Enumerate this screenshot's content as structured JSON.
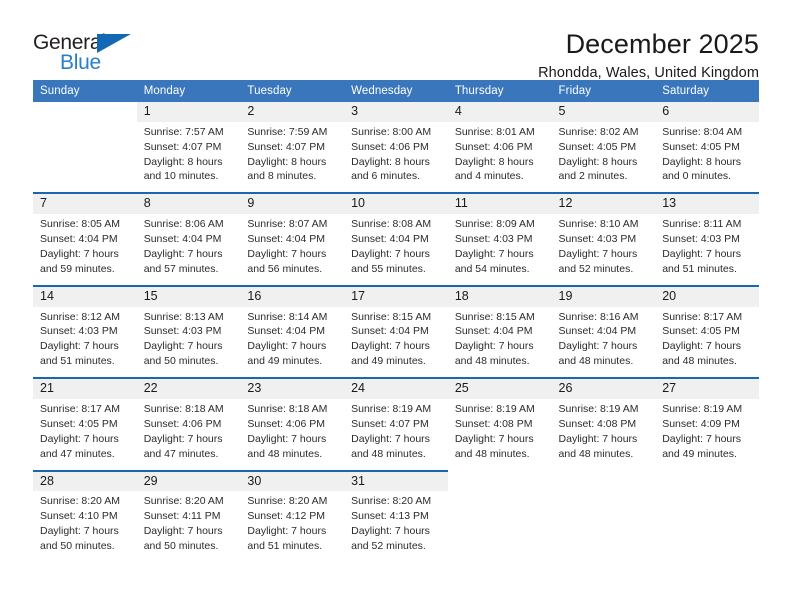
{
  "brand": {
    "word_one": "General",
    "word_two": "Blue",
    "triangle_icon": "triangle-icon",
    "accent_color": "#2a7fc9",
    "dark_color": "#231f20"
  },
  "header": {
    "title": "December 2025",
    "location": "Rhondda, Wales, United Kingdom"
  },
  "calendar": {
    "header_color": "#3a76bc",
    "separator_color": "#1768ad",
    "daynum_background": "#f0f0f0",
    "weekday_headers": [
      "Sunday",
      "Monday",
      "Tuesday",
      "Wednesday",
      "Thursday",
      "Friday",
      "Saturday"
    ],
    "weeks": [
      [
        {
          "day": "",
          "lines": []
        },
        {
          "day": "1",
          "lines": [
            "Sunrise: 7:57 AM",
            "Sunset: 4:07 PM",
            "Daylight: 8 hours",
            "and 10 minutes."
          ]
        },
        {
          "day": "2",
          "lines": [
            "Sunrise: 7:59 AM",
            "Sunset: 4:07 PM",
            "Daylight: 8 hours",
            "and 8 minutes."
          ]
        },
        {
          "day": "3",
          "lines": [
            "Sunrise: 8:00 AM",
            "Sunset: 4:06 PM",
            "Daylight: 8 hours",
            "and 6 minutes."
          ]
        },
        {
          "day": "4",
          "lines": [
            "Sunrise: 8:01 AM",
            "Sunset: 4:06 PM",
            "Daylight: 8 hours",
            "and 4 minutes."
          ]
        },
        {
          "day": "5",
          "lines": [
            "Sunrise: 8:02 AM",
            "Sunset: 4:05 PM",
            "Daylight: 8 hours",
            "and 2 minutes."
          ]
        },
        {
          "day": "6",
          "lines": [
            "Sunrise: 8:04 AM",
            "Sunset: 4:05 PM",
            "Daylight: 8 hours",
            "and 0 minutes."
          ]
        }
      ],
      [
        {
          "day": "7",
          "lines": [
            "Sunrise: 8:05 AM",
            "Sunset: 4:04 PM",
            "Daylight: 7 hours",
            "and 59 minutes."
          ]
        },
        {
          "day": "8",
          "lines": [
            "Sunrise: 8:06 AM",
            "Sunset: 4:04 PM",
            "Daylight: 7 hours",
            "and 57 minutes."
          ]
        },
        {
          "day": "9",
          "lines": [
            "Sunrise: 8:07 AM",
            "Sunset: 4:04 PM",
            "Daylight: 7 hours",
            "and 56 minutes."
          ]
        },
        {
          "day": "10",
          "lines": [
            "Sunrise: 8:08 AM",
            "Sunset: 4:04 PM",
            "Daylight: 7 hours",
            "and 55 minutes."
          ]
        },
        {
          "day": "11",
          "lines": [
            "Sunrise: 8:09 AM",
            "Sunset: 4:03 PM",
            "Daylight: 7 hours",
            "and 54 minutes."
          ]
        },
        {
          "day": "12",
          "lines": [
            "Sunrise: 8:10 AM",
            "Sunset: 4:03 PM",
            "Daylight: 7 hours",
            "and 52 minutes."
          ]
        },
        {
          "day": "13",
          "lines": [
            "Sunrise: 8:11 AM",
            "Sunset: 4:03 PM",
            "Daylight: 7 hours",
            "and 51 minutes."
          ]
        }
      ],
      [
        {
          "day": "14",
          "lines": [
            "Sunrise: 8:12 AM",
            "Sunset: 4:03 PM",
            "Daylight: 7 hours",
            "and 51 minutes."
          ]
        },
        {
          "day": "15",
          "lines": [
            "Sunrise: 8:13 AM",
            "Sunset: 4:03 PM",
            "Daylight: 7 hours",
            "and 50 minutes."
          ]
        },
        {
          "day": "16",
          "lines": [
            "Sunrise: 8:14 AM",
            "Sunset: 4:04 PM",
            "Daylight: 7 hours",
            "and 49 minutes."
          ]
        },
        {
          "day": "17",
          "lines": [
            "Sunrise: 8:15 AM",
            "Sunset: 4:04 PM",
            "Daylight: 7 hours",
            "and 49 minutes."
          ]
        },
        {
          "day": "18",
          "lines": [
            "Sunrise: 8:15 AM",
            "Sunset: 4:04 PM",
            "Daylight: 7 hours",
            "and 48 minutes."
          ]
        },
        {
          "day": "19",
          "lines": [
            "Sunrise: 8:16 AM",
            "Sunset: 4:04 PM",
            "Daylight: 7 hours",
            "and 48 minutes."
          ]
        },
        {
          "day": "20",
          "lines": [
            "Sunrise: 8:17 AM",
            "Sunset: 4:05 PM",
            "Daylight: 7 hours",
            "and 48 minutes."
          ]
        }
      ],
      [
        {
          "day": "21",
          "lines": [
            "Sunrise: 8:17 AM",
            "Sunset: 4:05 PM",
            "Daylight: 7 hours",
            "and 47 minutes."
          ]
        },
        {
          "day": "22",
          "lines": [
            "Sunrise: 8:18 AM",
            "Sunset: 4:06 PM",
            "Daylight: 7 hours",
            "and 47 minutes."
          ]
        },
        {
          "day": "23",
          "lines": [
            "Sunrise: 8:18 AM",
            "Sunset: 4:06 PM",
            "Daylight: 7 hours",
            "and 48 minutes."
          ]
        },
        {
          "day": "24",
          "lines": [
            "Sunrise: 8:19 AM",
            "Sunset: 4:07 PM",
            "Daylight: 7 hours",
            "and 48 minutes."
          ]
        },
        {
          "day": "25",
          "lines": [
            "Sunrise: 8:19 AM",
            "Sunset: 4:08 PM",
            "Daylight: 7 hours",
            "and 48 minutes."
          ]
        },
        {
          "day": "26",
          "lines": [
            "Sunrise: 8:19 AM",
            "Sunset: 4:08 PM",
            "Daylight: 7 hours",
            "and 48 minutes."
          ]
        },
        {
          "day": "27",
          "lines": [
            "Sunrise: 8:19 AM",
            "Sunset: 4:09 PM",
            "Daylight: 7 hours",
            "and 49 minutes."
          ]
        }
      ],
      [
        {
          "day": "28",
          "lines": [
            "Sunrise: 8:20 AM",
            "Sunset: 4:10 PM",
            "Daylight: 7 hours",
            "and 50 minutes."
          ]
        },
        {
          "day": "29",
          "lines": [
            "Sunrise: 8:20 AM",
            "Sunset: 4:11 PM",
            "Daylight: 7 hours",
            "and 50 minutes."
          ]
        },
        {
          "day": "30",
          "lines": [
            "Sunrise: 8:20 AM",
            "Sunset: 4:12 PM",
            "Daylight: 7 hours",
            "and 51 minutes."
          ]
        },
        {
          "day": "31",
          "lines": [
            "Sunrise: 8:20 AM",
            "Sunset: 4:13 PM",
            "Daylight: 7 hours",
            "and 52 minutes."
          ]
        },
        {
          "day": "",
          "lines": []
        },
        {
          "day": "",
          "lines": []
        },
        {
          "day": "",
          "lines": []
        }
      ]
    ]
  }
}
